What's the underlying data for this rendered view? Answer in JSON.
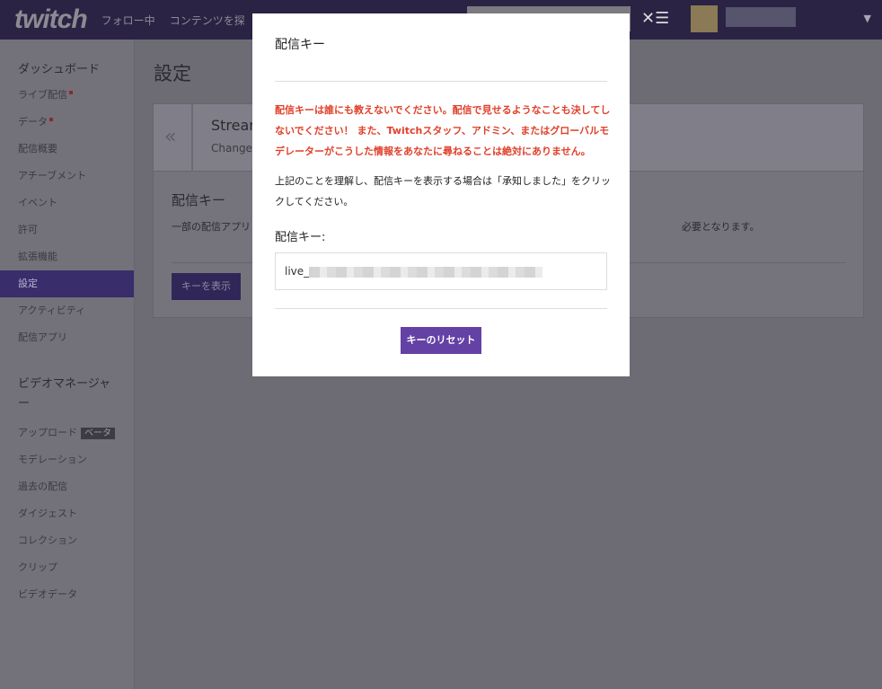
{
  "header": {
    "logo": "twitch",
    "nav": [
      "フォロー中",
      "コンテンツを探"
    ]
  },
  "sidebar": {
    "dashboard_heading": "ダッシュボード",
    "items": [
      {
        "label": "ライブ配信",
        "dot": true
      },
      {
        "label": "データ",
        "dot": true
      },
      {
        "label": "配信概要"
      },
      {
        "label": "アチーブメント"
      },
      {
        "label": "イベント"
      },
      {
        "label": "許可"
      },
      {
        "label": "拡張機能"
      },
      {
        "label": "設定",
        "active": true
      },
      {
        "label": "アクティビティ"
      },
      {
        "label": "配信アプリ"
      }
    ],
    "video_heading": "ビデオマネージャー",
    "video_items": [
      {
        "label": "アップロード",
        "badge": "ベータ"
      },
      {
        "label": "モデレーション"
      },
      {
        "label": "過去の配信"
      },
      {
        "label": "ダイジェスト"
      },
      {
        "label": "コレクション"
      },
      {
        "label": "クリップ"
      },
      {
        "label": "ビデオデータ"
      }
    ]
  },
  "main": {
    "title": "設定",
    "panel_heading": "Stream",
    "panel_sub": "Change",
    "key_title": "配信キー",
    "key_desc": "一部の配信アプリ",
    "key_desc_end": "必要となります。",
    "show_key_button": "キーを表示"
  },
  "modal": {
    "title": "配信キー",
    "warning": "配信キーは誰にも教えないでください。配信で見せるようなことも決してしないでください！ また、Twitchスタッフ、アドミン、またはグローバルモデレーターがこうした情報をあなたに尋ねることは絶対にありません。",
    "info": "上記のことを理解し、配信キーを表示する場合は「承知しました」をクリックしてください。",
    "key_label": "配信キー:",
    "key_prefix": "live_",
    "reset_button": "キーのリセット"
  },
  "colors": {
    "accent": "#6441a4",
    "warning": "#e0402a"
  }
}
